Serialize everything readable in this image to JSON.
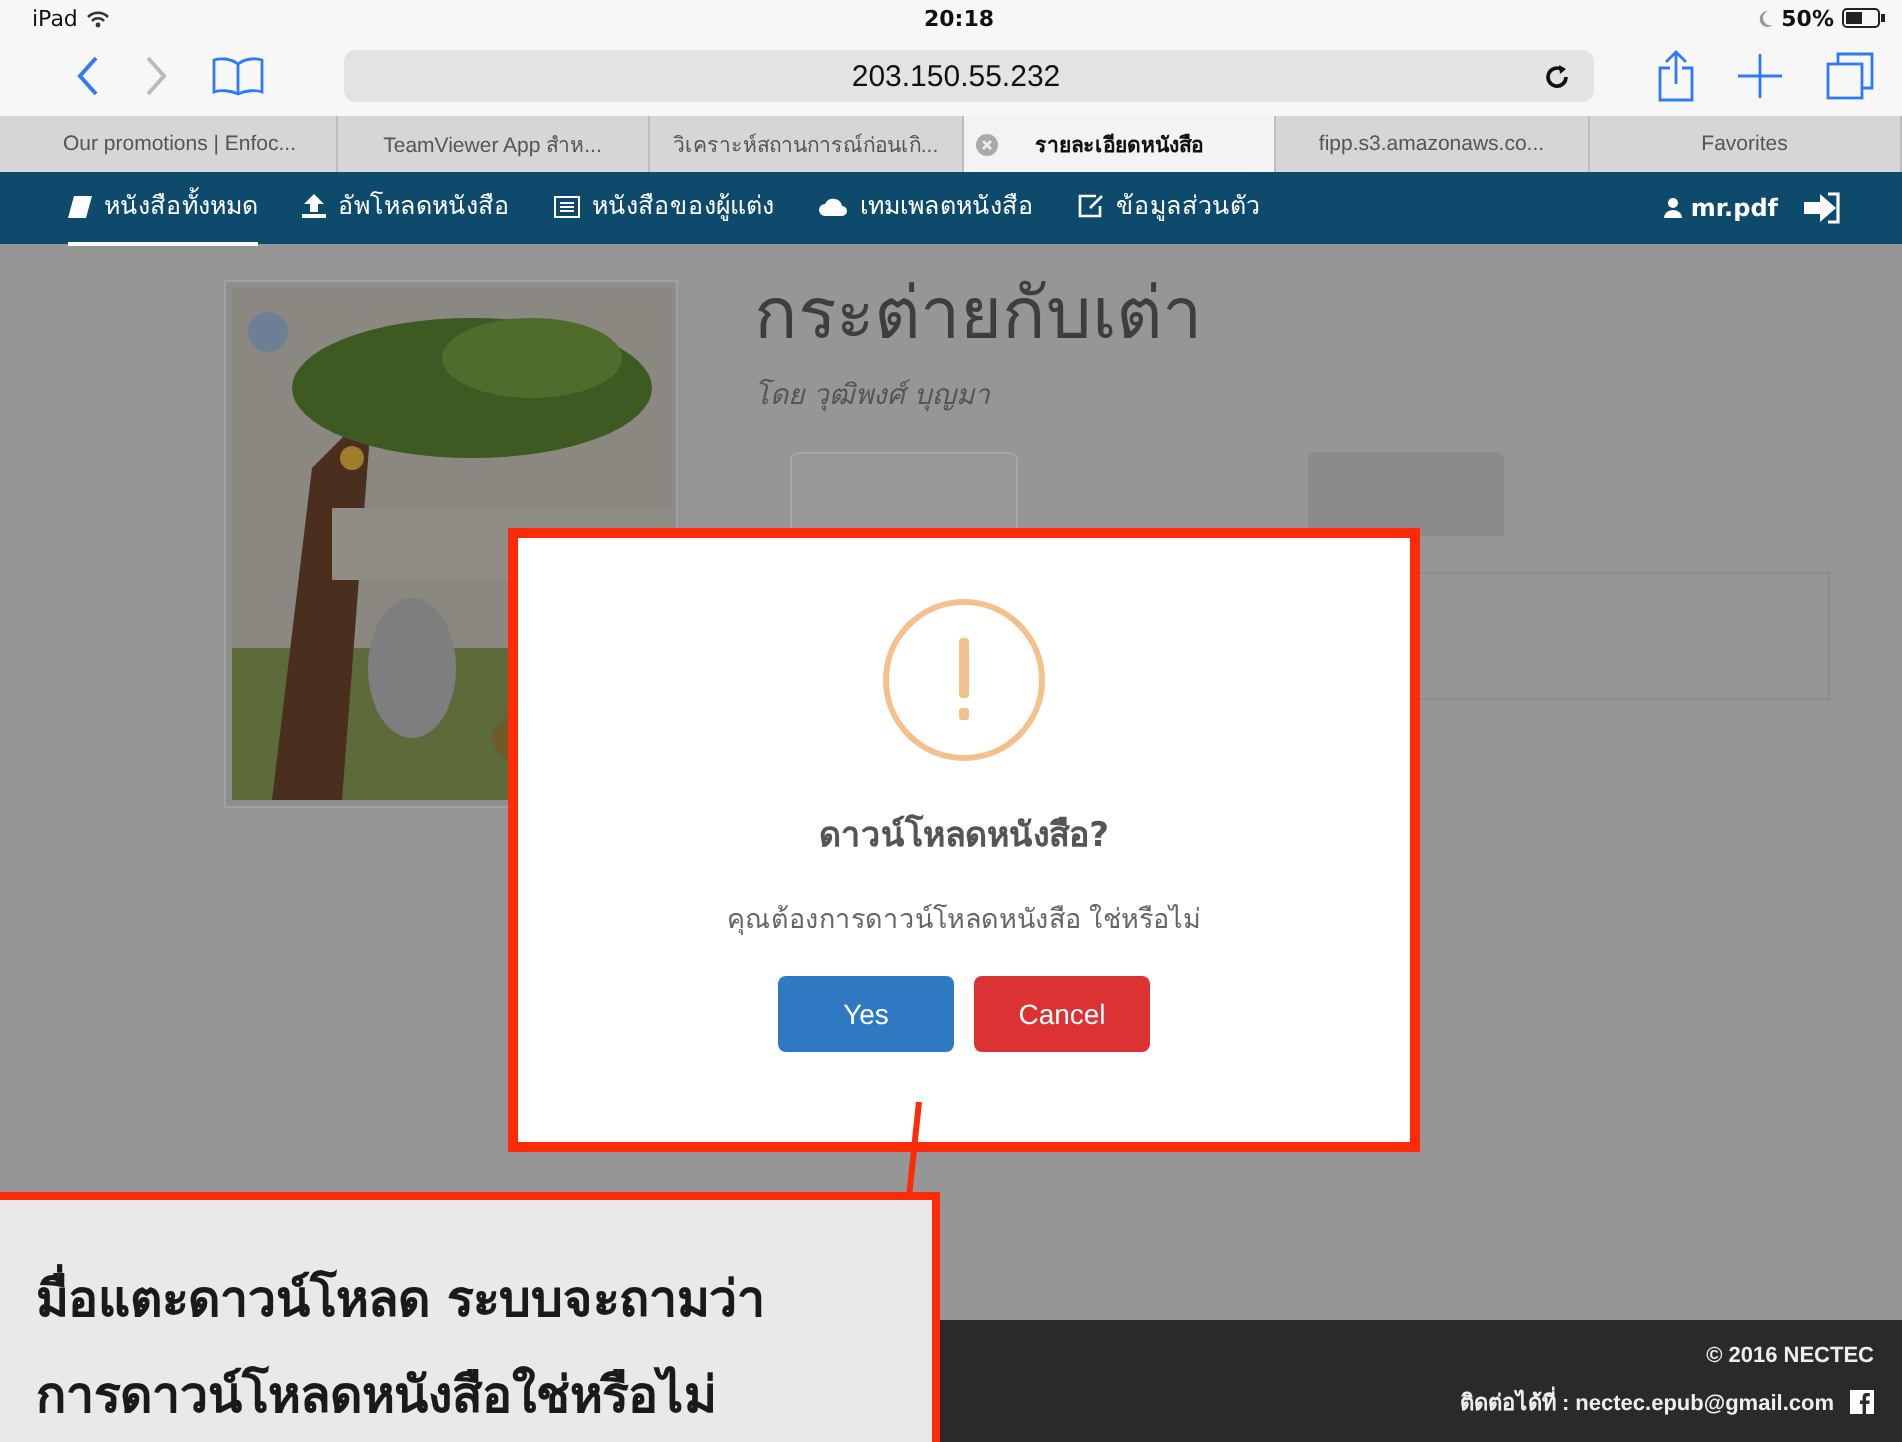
{
  "status_bar": {
    "device": "iPad",
    "time": "20:18",
    "battery": "50%"
  },
  "address_bar": {
    "url": "203.150.55.232"
  },
  "browser_tabs": [
    {
      "label": "Our promotions | Enfoc...",
      "selected": false
    },
    {
      "label": "TeamViewer App สำห...",
      "selected": false
    },
    {
      "label": "วิเคราะห์สถานการณ์ก่อนเกิ...",
      "selected": false
    },
    {
      "label": "รายละเอียดหนังสือ",
      "selected": true
    },
    {
      "label": "fipp.s3.amazonaws.co...",
      "selected": false
    },
    {
      "label": "Favorites",
      "selected": false
    }
  ],
  "nav": {
    "items": [
      {
        "label": "หนังสือทั้งหมด",
        "kind": "book",
        "selected": true
      },
      {
        "label": "อัพโหลดหนังสือ",
        "kind": "upload",
        "selected": false
      },
      {
        "label": "หนังสือของผู้แต่ง",
        "kind": "list",
        "selected": false
      },
      {
        "label": "เทมเพลตหนังสือ",
        "kind": "cloud",
        "selected": false
      },
      {
        "label": "ข้อมูลส่วนตัว",
        "kind": "edit",
        "selected": false
      }
    ],
    "user": "mr.pdf"
  },
  "book": {
    "title": "กระต่ายกับเต่า",
    "author": "โดย วุฒิพงศ์ บุญมา"
  },
  "dialog": {
    "title": "ดาวน์โหลดหนังสือ?",
    "message": "คุณต้องการดาวน์โหลดหนังสือ ใช่หรือไม่",
    "buttons": [
      {
        "label": "Yes",
        "kind": "confirm"
      },
      {
        "label": "Cancel",
        "kind": "cancel"
      }
    ]
  },
  "footer": {
    "copyright": "© 2016 NECTEC",
    "contact": "ติดต่อได้ที่ : nectec.epub@gmail.com"
  },
  "callout": {
    "lines": [
      "มื่อแตะดาวน์โหลด ระบบจะถามว่า",
      "การดาวน์โหลดหนังสือใช่หรือไม่"
    ]
  }
}
